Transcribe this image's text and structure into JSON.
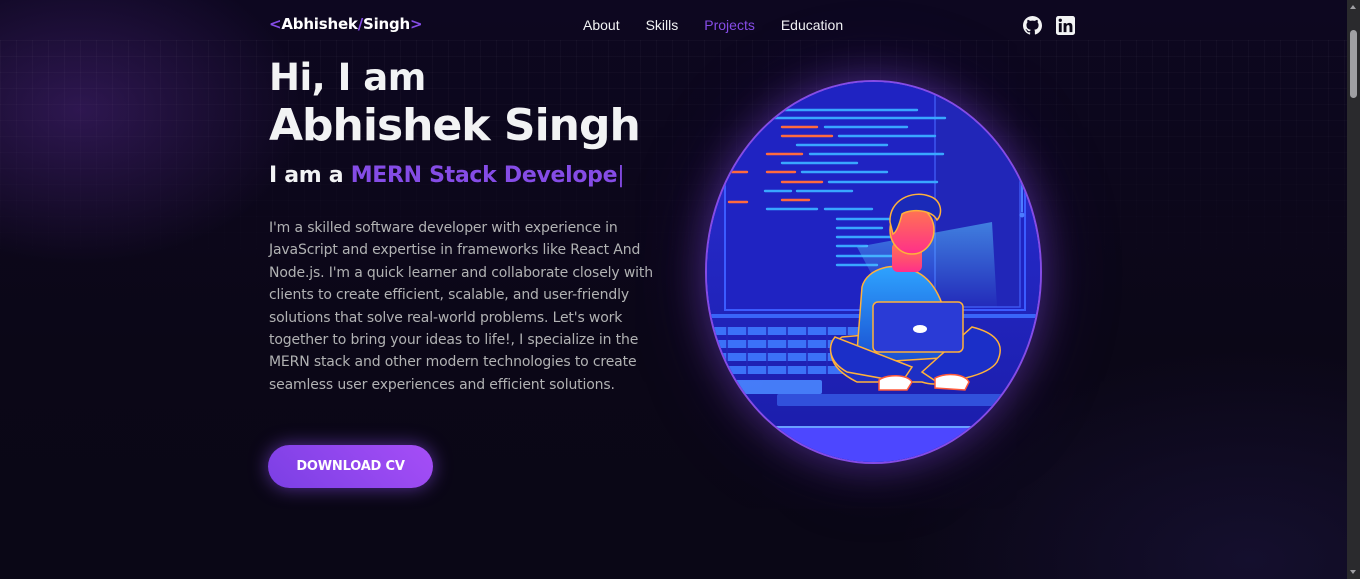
{
  "navbar": {
    "logo": {
      "open": "<",
      "first": "Abhishek",
      "slash": "/",
      "last": "Singh",
      "close": ">"
    },
    "links": [
      {
        "label": "About",
        "active": false
      },
      {
        "label": "Skills",
        "active": false
      },
      {
        "label": "Projects",
        "active": true
      },
      {
        "label": "Education",
        "active": false
      }
    ],
    "social": [
      {
        "icon": "github-icon"
      },
      {
        "icon": "linkedin-icon"
      }
    ]
  },
  "hero": {
    "greeting": "Hi, I am",
    "name": "Abhishek Singh",
    "role_prefix": "I am a",
    "role_typed": "MERN Stack Develope",
    "cursor": "|",
    "description": "I'm a skilled software developer with experience in JavaScript and expertise in frameworks like React And Node.js. I'm a quick learner and collaborate closely with clients to create efficient, scalable, and user-friendly solutions that solve real-world problems. Let's work together to bring your ideas to life!, I specialize in the MERN stack and other modern technologies to create seamless user experiences and efficient solutions.",
    "cta_label": "DOWNLOAD CV",
    "illustration": "developer-with-laptop-illustration"
  },
  "colors": {
    "accent": "#854ce6",
    "background": "#0b0717",
    "text_primary": "#f2f3f4",
    "text_secondary": "#b1b2b3"
  }
}
